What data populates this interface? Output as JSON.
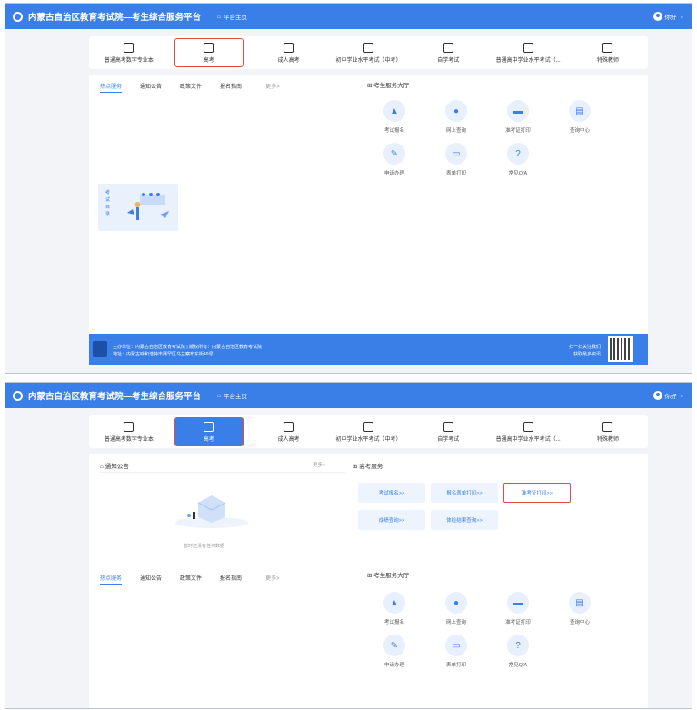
{
  "header": {
    "title": "内蒙古自治区教育考试院—考生综合服务平台",
    "home": "平台主页",
    "user": "你好"
  },
  "categories": [
    {
      "label": "普通高考数字专业本",
      "icon": "book-icon"
    },
    {
      "label": "高考",
      "icon": "graduation-icon"
    },
    {
      "label": "成人高考",
      "icon": "pencil-icon"
    },
    {
      "label": "初中学业水平考试（中考）",
      "icon": "edit-icon"
    },
    {
      "label": "自学考试",
      "icon": "monitor-icon"
    },
    {
      "label": "普通高中学业水平考试（...",
      "icon": "doc-icon"
    },
    {
      "label": "特殊教师",
      "icon": "cap-icon"
    }
  ],
  "menu": {
    "hot": "热点服务",
    "notice": "通知公告",
    "policy": "政策文件",
    "guide": "报名指南",
    "more": "更多>"
  },
  "hall": {
    "title": "考生服务大厅"
  },
  "services": [
    {
      "label": "考试报名"
    },
    {
      "label": "网上查询"
    },
    {
      "label": "准考证打印"
    },
    {
      "label": "查询中心"
    },
    {
      "label": "申请办理"
    },
    {
      "label": "表单打印"
    },
    {
      "label": "常见Q/A"
    }
  ],
  "banner": {
    "text": "考 试 目 录"
  },
  "footer": {
    "line1": "主办单位：内蒙古自治区教育考试院 | 版权所有：内蒙古自治区教育考试院",
    "line2": "地址：内蒙古呼和浩特市赛罕区乌兰察布东街49号",
    "qr1": "扫一扫关注我们",
    "qr2": "获取最多资讯"
  },
  "shot2": {
    "notice_title": "通知公告",
    "notice_more": "更多>",
    "gaokao_title": "高考服务",
    "nodata": "暂时还没有任何数据",
    "quick": [
      {
        "label": "考试报名>>"
      },
      {
        "label": "报名表单打印>>"
      },
      {
        "label": "准考证打印>>"
      },
      {
        "label": "成绩查询>>"
      },
      {
        "label": "体检结果查询>>"
      }
    ]
  }
}
